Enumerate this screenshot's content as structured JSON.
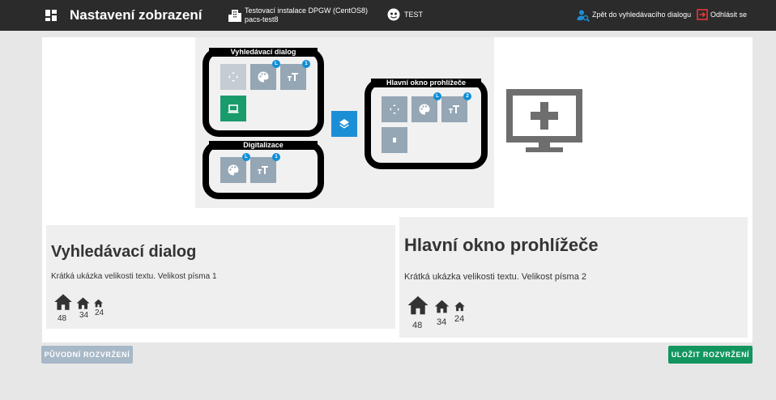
{
  "header": {
    "title": "Nastavení zobrazení",
    "instance_line1": "Testovací instalace DPGW (CentOS8)",
    "instance_line2": "pacs-test8",
    "user": "TEST",
    "back_link": "Zpět do vyhledávacího dialogu",
    "logout": "Odhlásit se"
  },
  "layout": {
    "search_dialog": {
      "title": "Vyhledávací dialog",
      "tiles": [
        {
          "icon": "move-icon",
          "badge": ""
        },
        {
          "icon": "palette-icon",
          "badge": "L"
        },
        {
          "icon": "text-size-icon",
          "badge": "1"
        },
        {
          "icon": "monitor-icon",
          "badge": ""
        }
      ]
    },
    "digitalization": {
      "title": "Digitalizace",
      "tiles": [
        {
          "icon": "palette-icon",
          "badge": "L"
        },
        {
          "icon": "text-size-icon",
          "badge": "1"
        }
      ]
    },
    "main_window": {
      "title": "Hlavní okno prohlížeče",
      "tiles": [
        {
          "icon": "move-icon",
          "badge": ""
        },
        {
          "icon": "palette-icon",
          "badge": "L"
        },
        {
          "icon": "text-size-icon",
          "badge": "2"
        },
        {
          "icon": "screen-icon",
          "badge": ""
        }
      ]
    },
    "layer_button_icon": "layers-icon",
    "add_monitor_icon": "add-monitor-icon"
  },
  "previews": [
    {
      "title": "Vyhledávací dialog",
      "text": "Krátká ukázka velikosti textu. Velikost písma 1",
      "sizes": [
        "48",
        "34",
        "24"
      ]
    },
    {
      "title": "Hlavní okno prohlížeče",
      "text": "Krátká ukázka velikosti textu. Velikost písma 2",
      "sizes": [
        "48",
        "34",
        "24"
      ]
    }
  ],
  "actions": {
    "reset": "PŮVODNÍ ROZVRŽENÍ",
    "save": "ULOŽIT ROZVRŽENÍ"
  },
  "colors": {
    "header_bg": "#2b2b2b",
    "accent_blue": "#1b8fd6",
    "save_green": "#12955f",
    "reset_gray": "#a7b8c7",
    "tile_gray": "#95a6b4",
    "logout_red": "#e53935"
  }
}
